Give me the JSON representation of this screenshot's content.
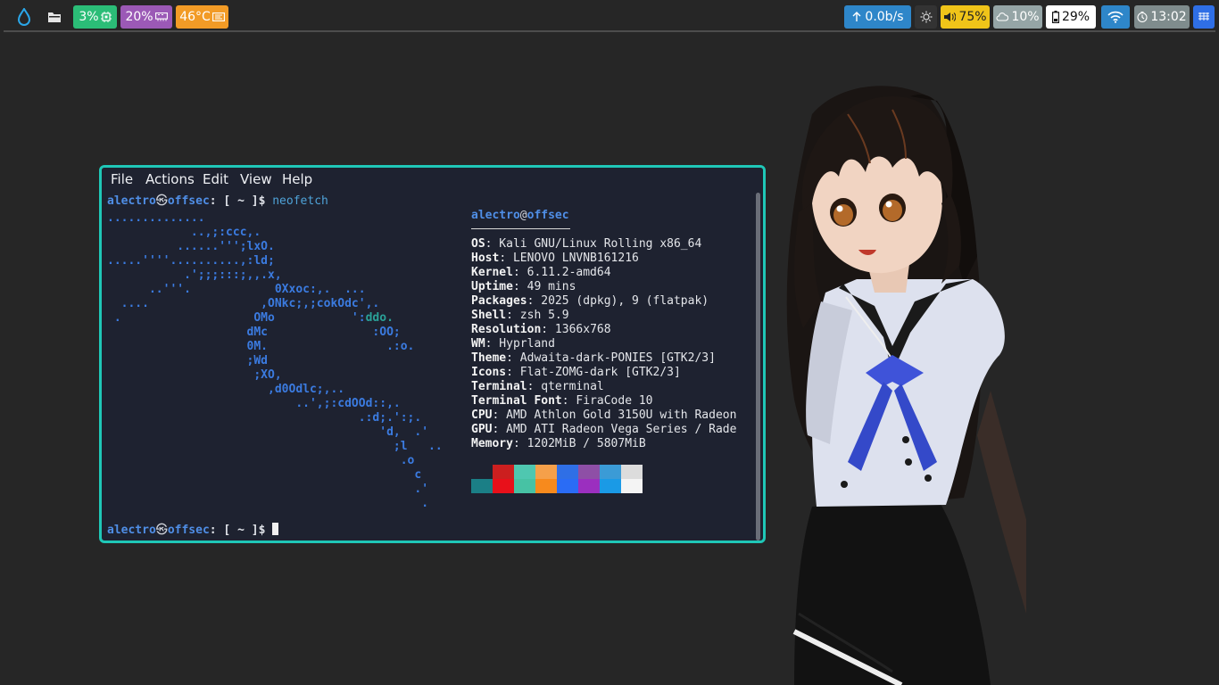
{
  "topbar": {
    "launcher_icon": "droplet-icon",
    "files_icon": "folder-icon",
    "cpu": {
      "value": "3%",
      "icon": "cpu-chip-icon",
      "color": "#2bbd77"
    },
    "memory": {
      "value": "20%",
      "icon": "memory-icon",
      "color": "#9b59b6"
    },
    "temperature": {
      "value": "46°C",
      "icon": "thermometer-icon",
      "color": "#f29b26"
    },
    "network": {
      "value": "0.0b/s",
      "icon": "network-activity-icon",
      "color": "#2e86c9"
    },
    "brightness_icon": "brightness-icon",
    "volume": {
      "value": "75%",
      "icon": "speaker-icon",
      "color": "#f0c419"
    },
    "weather": {
      "value": "10%",
      "icon": "cloud-icon",
      "color": "#95a5a6"
    },
    "battery": {
      "value": "29%",
      "icon": "battery-icon",
      "color": "#ffffff"
    },
    "wifi": {
      "icon": "wifi-icon",
      "color": "#2e86c9"
    },
    "clock": {
      "value": "13:02",
      "icon": "clock-icon",
      "color": "#7f8c8d"
    },
    "power_icon": "power-icon"
  },
  "terminal": {
    "menu": [
      "File",
      "Actions",
      "Edit",
      "View",
      "Help"
    ],
    "prompt": {
      "user": "alectro",
      "separator": "㉿",
      "host": "offsec",
      "rest": ": [ ~ ]$ "
    },
    "command": "neofetch",
    "ascii_art": [
      "..............",
      "            ..,;:ccc,.",
      "          ......''';lxO.",
      ".....''''..........,:ld;",
      "           .';;;:::;,,.x,",
      "      ..'''.            0Xxoc:,.  ...",
      "  ....                ,ONkc;,;cokOdc',.",
      " .                   OMo           ':",
      "                    dMc               :OO;",
      "                    0M.                 .:o.",
      "                    ;Wd",
      "                     ;XO,",
      "                       ,d0Odlc;,..",
      "                           ..',;:cdOOd::,.",
      "                                    .:d;.':;.",
      "                                       'd,  .'",
      "                                         ;l   ..",
      "                                          .o",
      "                                            c",
      "                                            .'",
      "                                             ."
    ],
    "ascii_teal": "ddo.",
    "info_user": "alectro",
    "info_at": "@",
    "info_host": "offsec",
    "info": [
      {
        "key": "OS",
        "value": "Kali GNU/Linux Rolling x86_64"
      },
      {
        "key": "Host",
        "value": "LENOVO LNVNB161216"
      },
      {
        "key": "Kernel",
        "value": "6.11.2-amd64"
      },
      {
        "key": "Uptime",
        "value": "49 mins"
      },
      {
        "key": "Packages",
        "value": "2025 (dpkg), 9 (flatpak)"
      },
      {
        "key": "Shell",
        "value": "zsh 5.9"
      },
      {
        "key": "Resolution",
        "value": "1366x768"
      },
      {
        "key": "WM",
        "value": "Hyprland"
      },
      {
        "key": "Theme",
        "value": "Adwaita-dark-PONIES [GTK2/3]"
      },
      {
        "key": "Icons",
        "value": "Flat-ZOMG-dark [GTK2/3]"
      },
      {
        "key": "Terminal",
        "value": "qterminal"
      },
      {
        "key": "Terminal Font",
        "value": "FiraCode 10"
      },
      {
        "key": "CPU",
        "value": "AMD Athlon Gold 3150U with Radeon"
      },
      {
        "key": "GPU",
        "value": "AMD ATI Radeon Vega Series / Rade"
      },
      {
        "key": "Memory",
        "value": "1202MiB / 5807MiB"
      }
    ],
    "palette_top": [
      "#1e2230",
      "#cc1f1f",
      "#4fc7b0",
      "#f5a04a",
      "#2f6fe6",
      "#8e4fa6",
      "#3b9bd6",
      "#dcdcdc"
    ],
    "palette_bottom": [
      "#1b7f86",
      "#e8101a",
      "#47c2a4",
      "#f78a1d",
      "#2a6cf5",
      "#9b2fbf",
      "#1a9ae6",
      "#f4f4f4"
    ]
  }
}
